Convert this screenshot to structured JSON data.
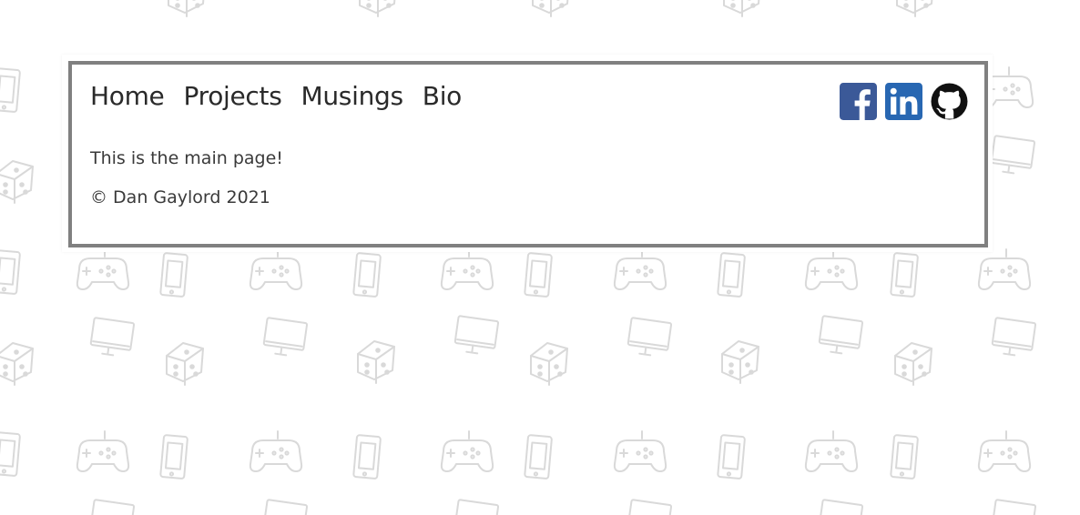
{
  "nav": {
    "items": [
      {
        "label": "Home"
      },
      {
        "label": "Projects"
      },
      {
        "label": "Musings"
      },
      {
        "label": "Bio"
      }
    ]
  },
  "social": {
    "items": [
      {
        "icon": "facebook-icon",
        "color": "#3b5998"
      },
      {
        "icon": "linkedin-icon",
        "color": "#2867b2"
      },
      {
        "icon": "github-icon",
        "color": "#111111"
      }
    ]
  },
  "main": {
    "text": "This is the main page!"
  },
  "footer": {
    "text": "© Dan Gaylord 2021"
  },
  "colors": {
    "background": "#ffffff",
    "pattern": "#dcdcdc",
    "card_border": "#808080",
    "text": "#333333"
  },
  "background_pattern": {
    "icon_names": [
      "game-controller-icon",
      "smartphone-icon",
      "monitor-icon",
      "dice-icon"
    ]
  }
}
